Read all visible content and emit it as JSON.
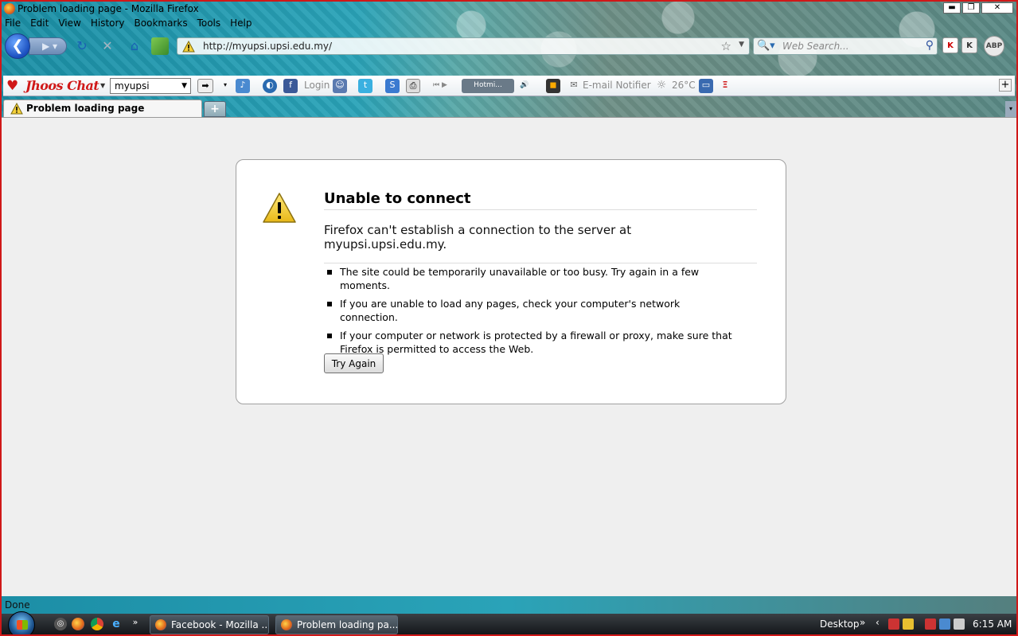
{
  "window": {
    "title": "Problem loading page - Mozilla Firefox",
    "controls": {
      "minimize": "▬",
      "maximize": "❐",
      "close": "✕"
    }
  },
  "menu": [
    "File",
    "Edit",
    "View",
    "History",
    "Bookmarks",
    "Tools",
    "Help"
  ],
  "nav": {
    "url": "http://myupsi.upsi.edu.my/",
    "search_placeholder": "Web Search...",
    "abp_label": "ABP"
  },
  "toolbar2": {
    "brand": "Jhoos Chat",
    "select_value": "myupsi",
    "login_label": "Login",
    "radio_label": "Hotmi...",
    "email_notifier": "E-mail Notifier",
    "temperature": "26°C"
  },
  "tabs": [
    {
      "label": "Problem loading page",
      "active": true
    }
  ],
  "error": {
    "title": "Unable to connect",
    "short_desc": "Firefox can't establish a connection to the server at myupsi.upsi.edu.my.",
    "items": [
      "The site could be temporarily unavailable or too busy. Try again in a few moments.",
      "If you are unable to load any pages, check your computer's network connection.",
      "If your computer or network is protected by a firewall or proxy, make sure that Firefox is permitted to access the Web."
    ],
    "button": "Try Again"
  },
  "status": {
    "text": "Done"
  },
  "taskbar": {
    "tasks": [
      "Facebook - Mozilla ...",
      "Problem loading pa..."
    ],
    "desktop_label": "Desktop",
    "clock": "6:15 AM"
  },
  "colors": {
    "frame_border": "#d01818",
    "chrome_teal": "#2aa3b8",
    "taskbar": "#1c2126"
  }
}
